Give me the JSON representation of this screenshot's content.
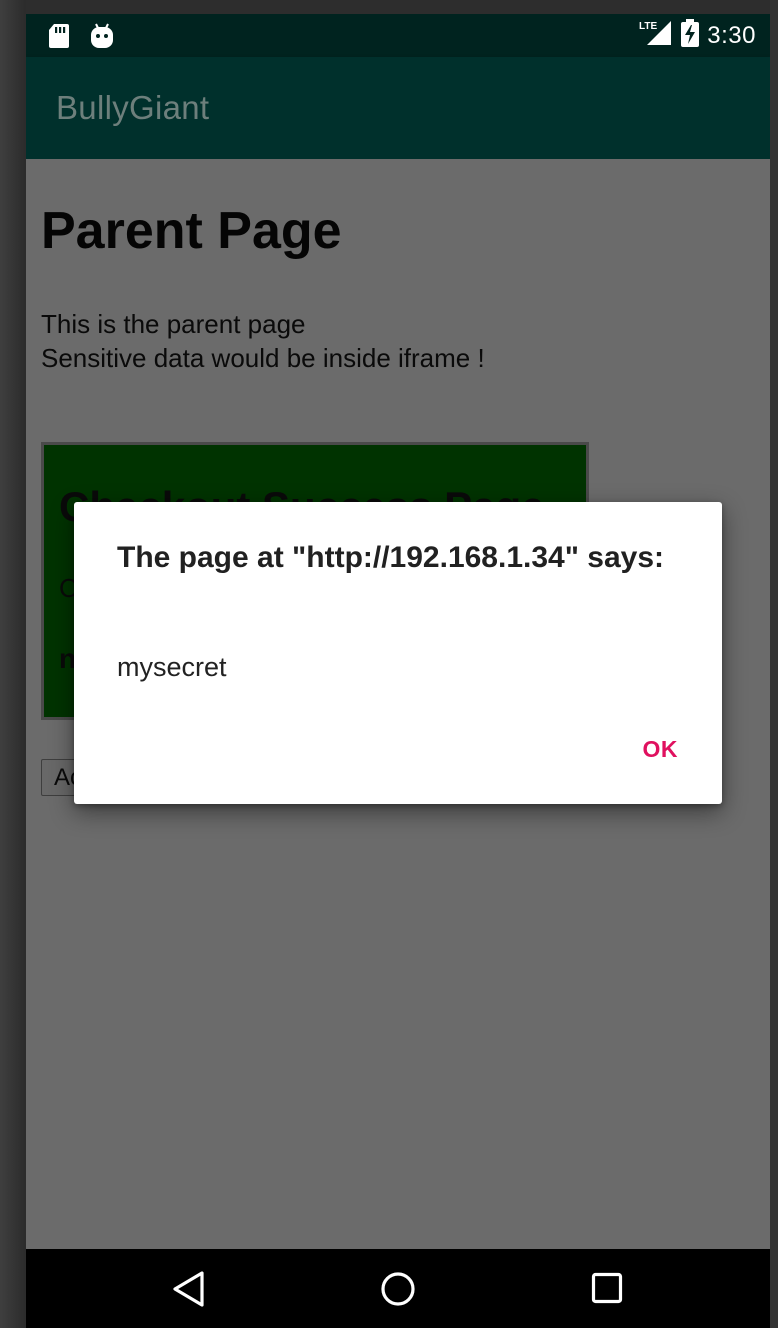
{
  "status_bar": {
    "time": "3:30",
    "network": "LTE",
    "icons": [
      "sd-card-icon",
      "android-icon",
      "lte-signal-icon",
      "battery-charging-icon"
    ]
  },
  "app_bar": {
    "title": "BullyGiant"
  },
  "web_page": {
    "heading": "Parent Page",
    "paragraph_line1": "This is the parent page",
    "paragraph_line2": "Sensitive data would be inside iframe !",
    "iframe": {
      "heading": "Checkout Success Page",
      "line1": "C",
      "line2": "n"
    },
    "button_label": "Ac"
  },
  "dialog": {
    "title": "The page at \"http://192.168.1.34\" says:",
    "message": "mysecret",
    "ok_label": "OK"
  },
  "nav_bar": {
    "icons": [
      "back-icon",
      "home-icon",
      "recents-icon"
    ]
  },
  "colors": {
    "status_bar": "#00231f",
    "app_bar": "#00302c",
    "dim_overlay": "#6b6b6b",
    "iframe_bg": "#003300",
    "dialog_accent": "#e0115f"
  }
}
